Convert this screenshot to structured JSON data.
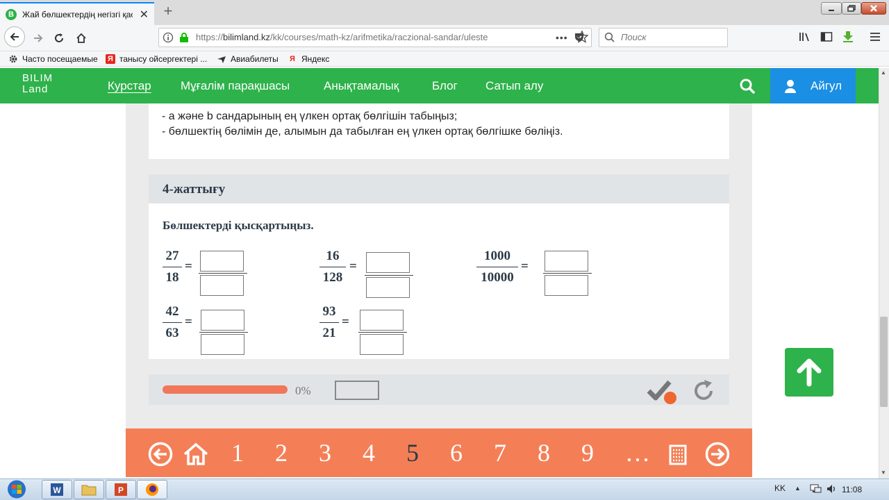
{
  "browser": {
    "tab_title": "Жай бөлшектердің негізгі қасиеттері",
    "tab_favicon": "B",
    "url_prefix": "https://",
    "url_domain": "bilimland.kz",
    "url_path": "/kk/courses/math-kz/arifmetika/raczional-sandar/uleste",
    "search_placeholder": "Поиск",
    "bookmarks": [
      {
        "icon": "gear-icon",
        "label": "Часто посещаемые"
      },
      {
        "icon": "yandex-icon",
        "label": "танысу ойсергектері ..."
      },
      {
        "icon": "plane-icon",
        "label": "Авиабилеты"
      },
      {
        "icon": "yandex-icon",
        "label": "Яндекс"
      }
    ]
  },
  "site": {
    "logo_line1": "BILIM",
    "logo_line2": "Land",
    "nav": [
      "Курстар",
      "Мұғалім парақшасы",
      "Анықтамалық",
      "Блог",
      "Сатып алу"
    ],
    "user_name": "Айгул",
    "brand_color": "#2eb24b",
    "user_color": "#1a8fe3"
  },
  "rules": [
    "- a және b сандарының ең үлкен ортақ бөлгішін табыңыз;",
    "- бөлшектің бөлімін де, алымын да табылған ең үлкен ортақ бөлгішке бөліңіз."
  ],
  "exercise": {
    "title": "4-жаттығу",
    "task": "Бөлшектерді қысқартыңыз.",
    "equals": "=",
    "fractions": [
      {
        "num": "27",
        "den": "18"
      },
      {
        "num": "16",
        "den": "128"
      },
      {
        "num": "1000",
        "den": "10000"
      },
      {
        "num": "42",
        "den": "63"
      },
      {
        "num": "93",
        "den": "21"
      }
    ]
  },
  "progress": {
    "percent_label": "0%",
    "value": 0,
    "color": "#f0775a"
  },
  "pager": {
    "pages": [
      "1",
      "2",
      "3",
      "4",
      "5",
      "6",
      "7",
      "8",
      "9"
    ],
    "current": "5",
    "ellipsis": "…",
    "color": "#f47f57"
  },
  "taskbar": {
    "lang": "KK",
    "clock": "11:08"
  }
}
